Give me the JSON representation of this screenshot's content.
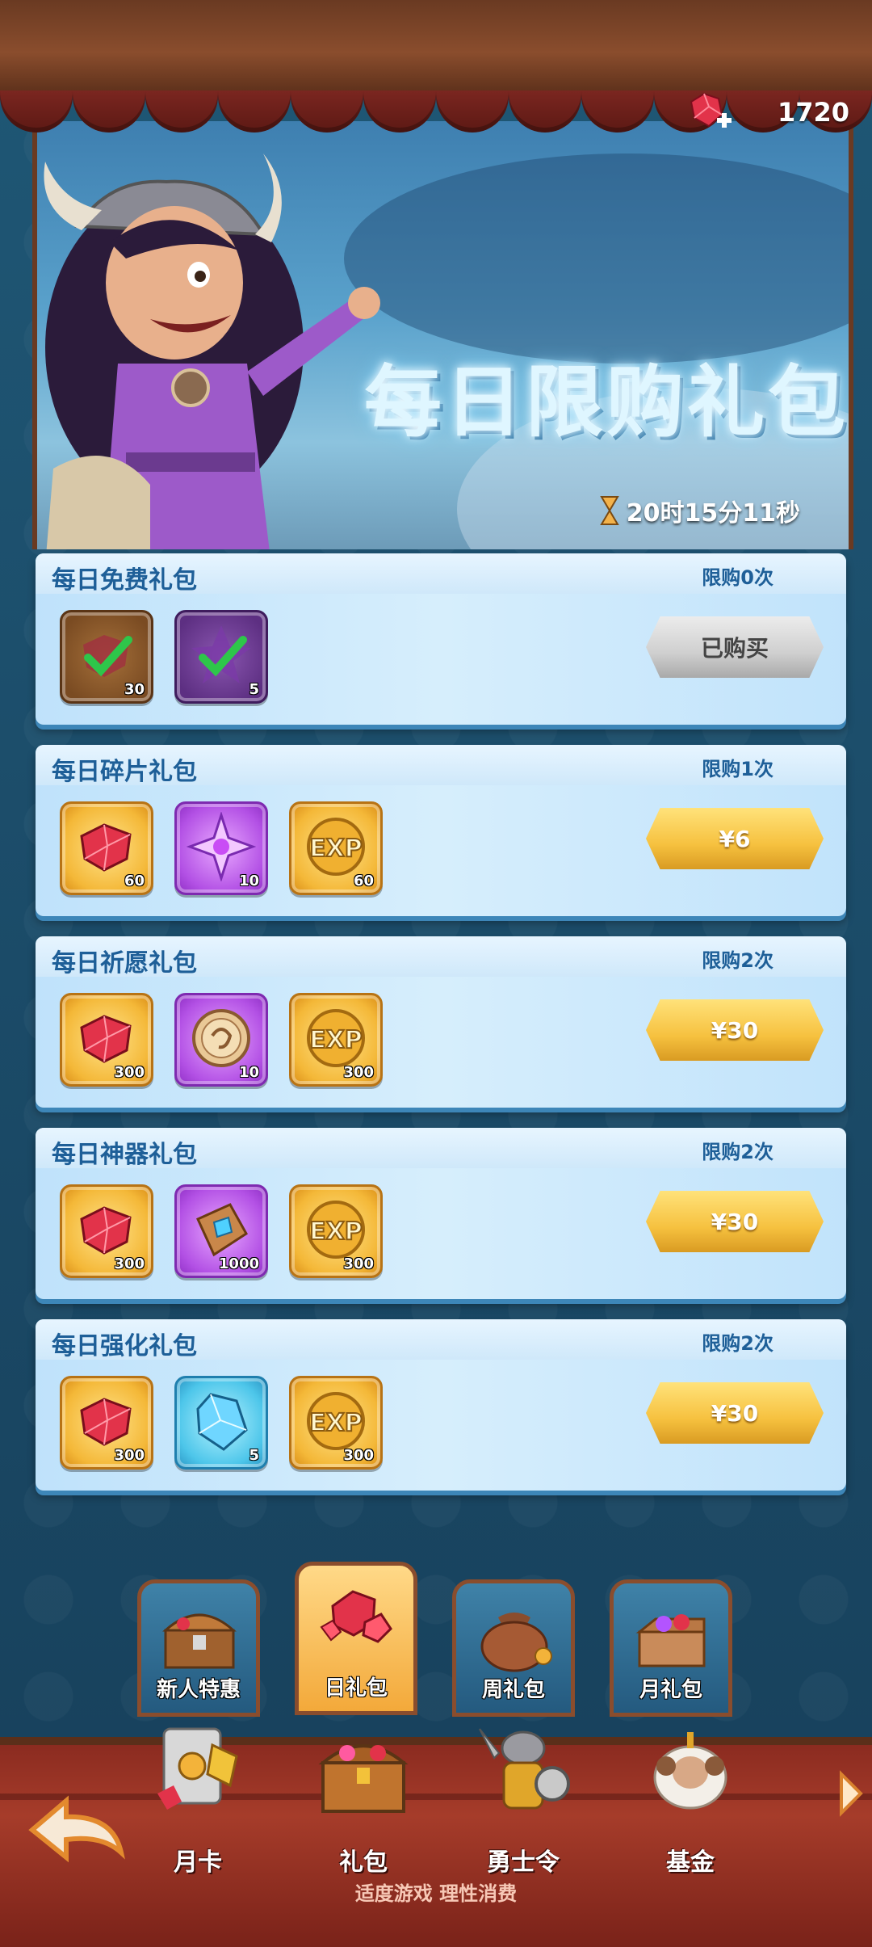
{
  "header": {
    "currency_amount": "1720",
    "currency_icon": "ruby-plus-icon"
  },
  "banner": {
    "title": "每日限购礼包",
    "timer": "20时15分11秒",
    "timer_icon": "hourglass-icon"
  },
  "packs": [
    {
      "title": "每日免费礼包",
      "limit": "限购0次",
      "button": "已购买",
      "button_state": "purchased",
      "items": [
        {
          "icon": "ruby-icon",
          "qty": "30",
          "claimed": true
        },
        {
          "icon": "star-shard-icon",
          "qty": "5",
          "claimed": true
        }
      ]
    },
    {
      "title": "每日碎片礼包",
      "limit": "限购1次",
      "button": "¥6",
      "button_state": "available",
      "items": [
        {
          "icon": "ruby-icon",
          "qty": "60"
        },
        {
          "icon": "star-shard-icon",
          "qty": "10"
        },
        {
          "icon": "exp-icon",
          "qty": "60"
        }
      ]
    },
    {
      "title": "每日祈愿礼包",
      "limit": "限购2次",
      "button": "¥30",
      "button_state": "available",
      "items": [
        {
          "icon": "ruby-icon",
          "qty": "300"
        },
        {
          "icon": "wish-coin-icon",
          "qty": "10"
        },
        {
          "icon": "exp-icon",
          "qty": "300"
        }
      ]
    },
    {
      "title": "每日神器礼包",
      "limit": "限购2次",
      "button": "¥30",
      "button_state": "available",
      "items": [
        {
          "icon": "ruby-icon",
          "qty": "300"
        },
        {
          "icon": "artifact-crystal-icon",
          "qty": "1000"
        },
        {
          "icon": "exp-icon",
          "qty": "300"
        }
      ]
    },
    {
      "title": "每日强化礼包",
      "limit": "限购2次",
      "button": "¥30",
      "button_state": "available",
      "items": [
        {
          "icon": "ruby-icon",
          "qty": "300"
        },
        {
          "icon": "blue-crystal-icon",
          "qty": "5"
        },
        {
          "icon": "exp-icon",
          "qty": "300"
        }
      ]
    }
  ],
  "tabs": [
    {
      "label": "新人特惠",
      "icon": "treasure-chest-icon",
      "active": false
    },
    {
      "label": "日礼包",
      "icon": "ruby-pile-icon",
      "active": true
    },
    {
      "label": "周礼包",
      "icon": "coin-sack-icon",
      "active": false
    },
    {
      "label": "月礼包",
      "icon": "gem-crate-icon",
      "active": false
    }
  ],
  "bottom_nav": [
    {
      "label": "月卡",
      "icon": "card-coins-icon"
    },
    {
      "label": "礼包",
      "icon": "gift-chest-icon"
    },
    {
      "label": "勇士令",
      "icon": "warrior-icon"
    },
    {
      "label": "基金",
      "icon": "sheep-icon"
    }
  ],
  "footer": {
    "slogan": "适度游戏 理性消费"
  },
  "colors": {
    "accent_gold": "#f6c13f",
    "card_blue": "#cfe8fa",
    "title_blue": "#1e5f98"
  }
}
